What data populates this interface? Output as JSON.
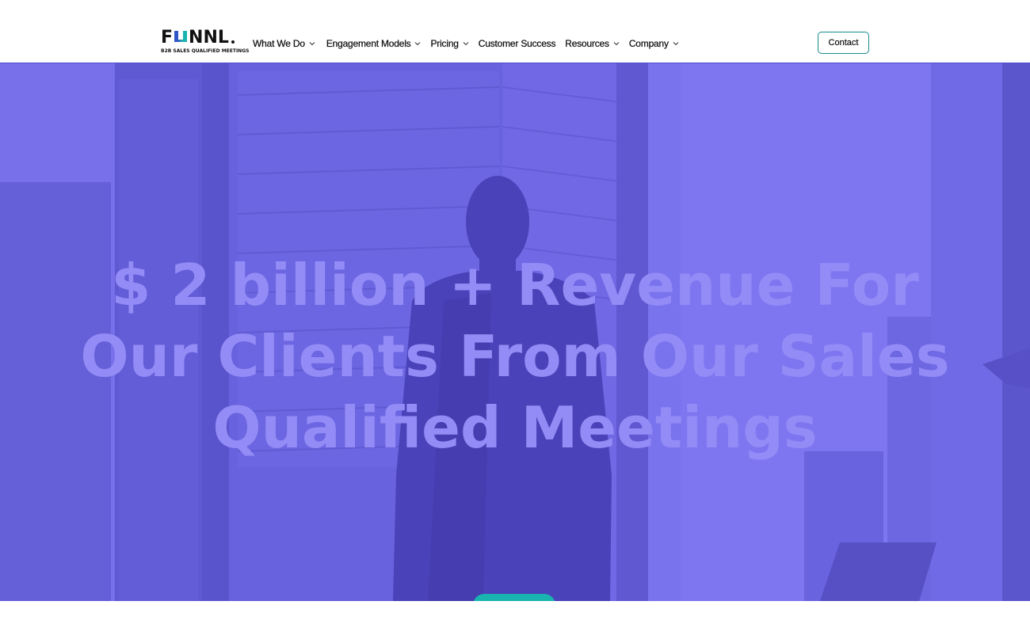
{
  "brand": {
    "logo_prefix": "F",
    "logo_suffix": "NNL",
    "tagline": "B2B SALES QUALIFIED MEETINGS",
    "colors": {
      "accent_teal": "#1a8a8a",
      "logo_blue": "#2f57c8",
      "logo_teal": "#19b3b0",
      "hero_overlay": "#6d66e6",
      "hero_text": "#938cf6"
    }
  },
  "nav": {
    "items": [
      {
        "label": "What We Do",
        "dropdown": true
      },
      {
        "label": "Engagement Models",
        "dropdown": true
      },
      {
        "label": "Pricing",
        "dropdown": true
      },
      {
        "label": "Customer Success",
        "dropdown": false
      },
      {
        "label": "Resources",
        "dropdown": true
      },
      {
        "label": "Company",
        "dropdown": true
      }
    ],
    "contact_label": "Contact"
  },
  "hero": {
    "headline": "$ 2 billion + Revenue For Our Clients From Our Sales Qualified Meetings"
  }
}
